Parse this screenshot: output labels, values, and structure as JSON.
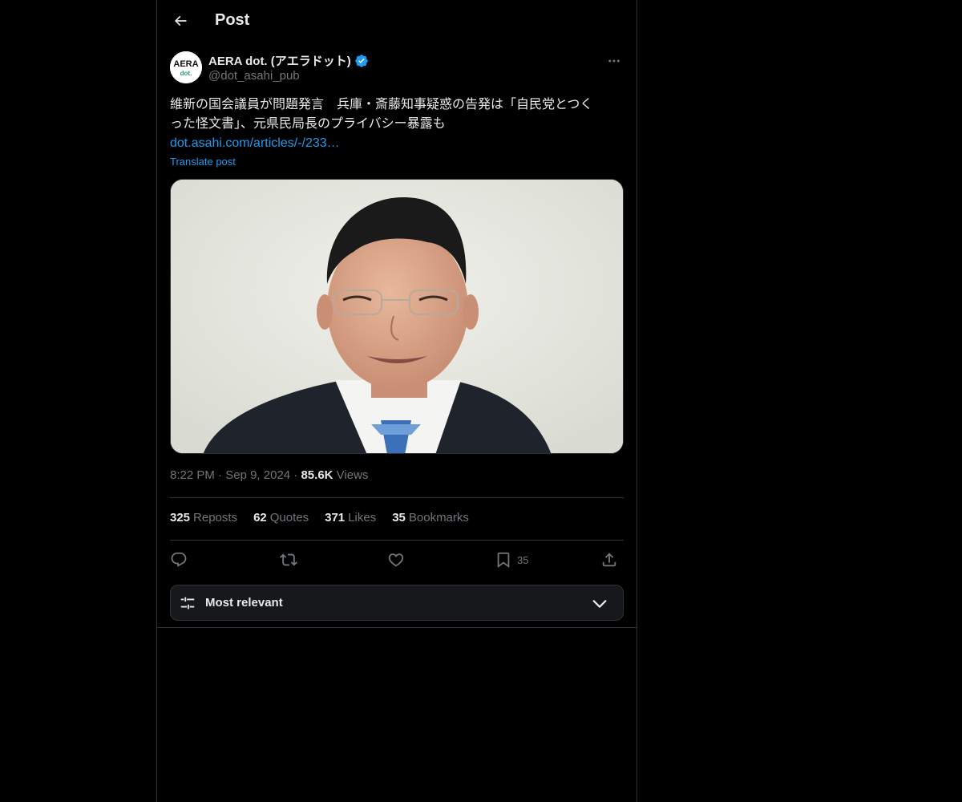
{
  "header": {
    "title": "Post",
    "back_icon": "arrow-left-icon"
  },
  "author": {
    "display_name": "AERA dot. (アエラドット)",
    "handle": "@dot_asahi_pub",
    "verified": true,
    "avatar_text_top": "AERA",
    "avatar_text_bottom": "dot."
  },
  "post": {
    "text_line1": "維新の国会議員が問題発言　兵庫・斎藤知事疑惑の告発は「自民党とつく",
    "text_line2": "った怪文書」、元県民局長のプライバシー暴露も",
    "link": "dot.asahi.com/articles/-/233…",
    "translate_label": "Translate post",
    "media_alt": "photo of a man in a suit and glasses"
  },
  "meta": {
    "time": "8:22 PM",
    "sep": "·",
    "date": "Sep 9, 2024",
    "views_count": "85.6K",
    "views_label": "Views"
  },
  "stats": [
    {
      "count": "325",
      "label": "Reposts"
    },
    {
      "count": "62",
      "label": "Quotes"
    },
    {
      "count": "371",
      "label": "Likes"
    },
    {
      "count": "35",
      "label": "Bookmarks"
    }
  ],
  "actions": {
    "reply_icon": "reply-icon",
    "repost_icon": "repost-icon",
    "like_icon": "heart-icon",
    "bookmark_icon": "bookmark-icon",
    "bookmark_count": "35",
    "share_icon": "share-icon"
  },
  "sort": {
    "label": "Most relevant"
  },
  "colors": {
    "accent": "#1d9bf0",
    "muted": "#71767b",
    "border": "#2f3336",
    "text": "#e7e9ea"
  }
}
